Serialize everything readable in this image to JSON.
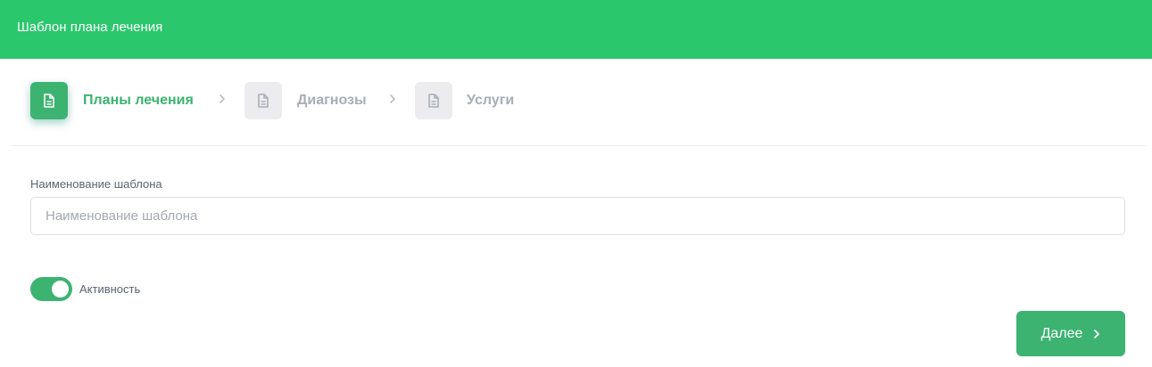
{
  "header": {
    "title": "Шаблон плана лечения"
  },
  "steps": [
    {
      "label": "Планы лечения",
      "state": "active",
      "icon": "document-icon"
    },
    {
      "label": "Диагнозы",
      "state": "inactive",
      "icon": "document-icon"
    },
    {
      "label": "Услуги",
      "state": "inactive",
      "icon": "document-icon"
    }
  ],
  "form": {
    "name_label": "Наименование шаблона",
    "name_placeholder": "Наименование шаблона",
    "name_value": "",
    "active_label": "Активность",
    "active_on": true
  },
  "actions": {
    "next_label": "Далее",
    "next_icon": "chevron-right-icon"
  },
  "colors": {
    "header_bg": "#2bc76c",
    "accent": "#3cb371",
    "inactive_text": "#a9adb7",
    "inactive_icon_bg": "#ececef"
  }
}
